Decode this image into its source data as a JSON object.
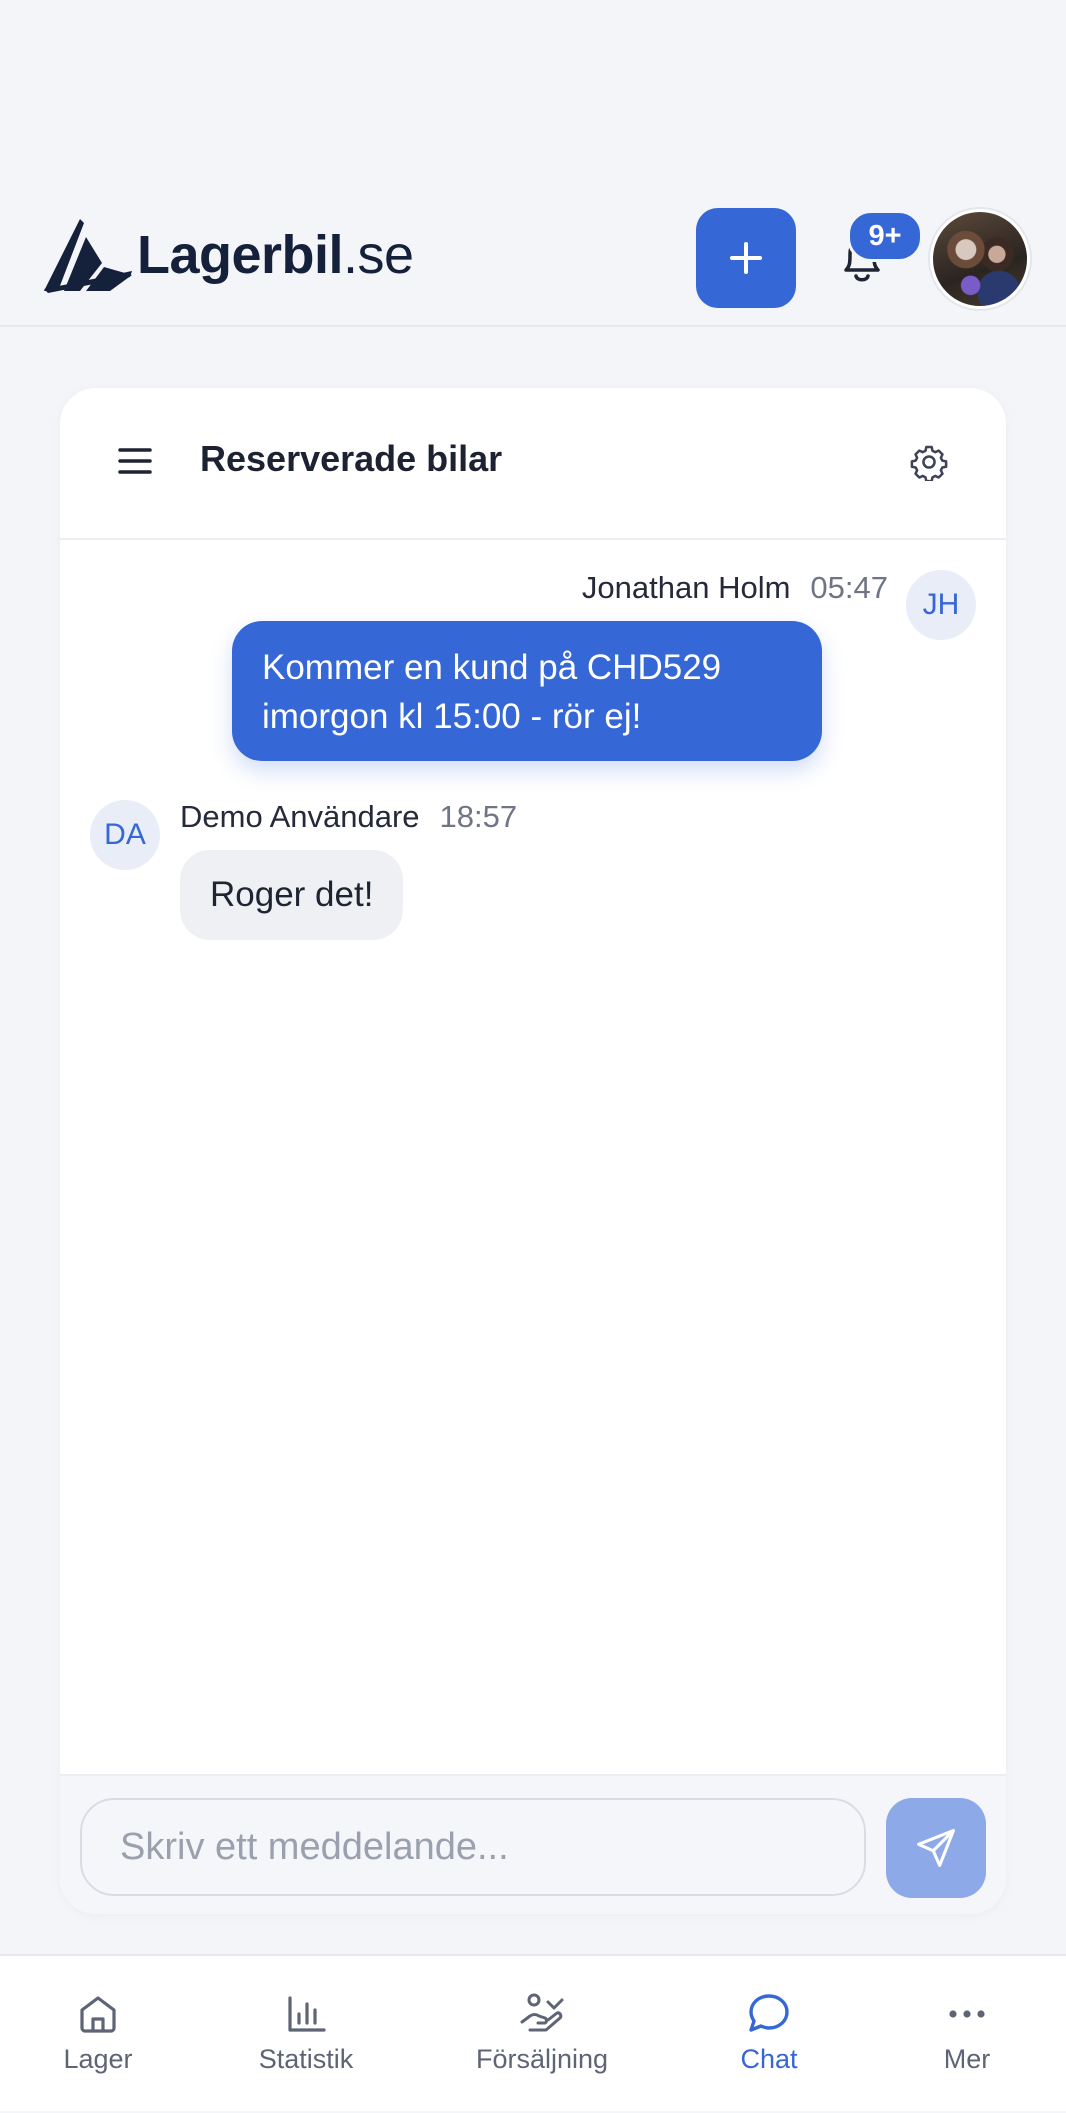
{
  "header": {
    "brand": "Lagerbil",
    "brand_suffix": ".se",
    "notification_count": "9+"
  },
  "chat": {
    "room_title": "Reserverade bilar",
    "messages": [
      {
        "sender": "Jonathan Holm",
        "initials": "JH",
        "time": "05:47",
        "text": "Kommer en kund på CHD529 imorgon kl 15:00 - rör ej!",
        "own": true
      },
      {
        "sender": "Demo Användare",
        "initials": "DA",
        "time": "18:57",
        "text": "Roger det!",
        "own": false
      }
    ],
    "composer": {
      "placeholder": "Skriv ett meddelande...",
      "value": ""
    }
  },
  "nav": {
    "items": [
      {
        "label": "Lager",
        "icon": "home-icon"
      },
      {
        "label": "Statistik",
        "icon": "bar-chart-icon"
      },
      {
        "label": "Försäljning",
        "icon": "hand-coin-icon"
      },
      {
        "label": "Chat",
        "icon": "chat-bubble-icon",
        "active": true
      },
      {
        "label": "Mer",
        "icon": "more-dots-icon"
      }
    ]
  },
  "colors": {
    "accent": "#3567d6",
    "background": "#f4f5f8",
    "send_disabled": "#8ea9e8"
  }
}
